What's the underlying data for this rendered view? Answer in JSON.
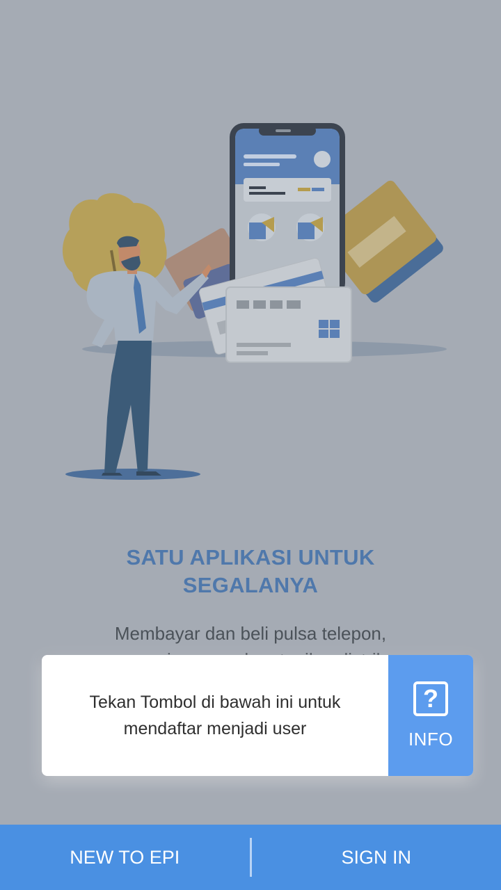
{
  "onboarding": {
    "title_line1": "SATU APLIKASI UNTUK",
    "title_line2": "SEGALANYA",
    "description_line1": "Membayar dan beli pulsa telepon,",
    "description_line2": "permainan voucher, tagihan listrik"
  },
  "tooltip": {
    "line1": "Tekan Tombol di bawah ini untuk",
    "line2": "mendaftar menjadi user",
    "info_label": "INFO",
    "info_icon": "question-mark-icon"
  },
  "bottom_bar": {
    "new_label": "NEW TO EPI",
    "signin_label": "SIGN IN"
  },
  "colors": {
    "overlay_background": "#a5abb4",
    "title": "#4f78ab",
    "info_button": "#5c9cee",
    "bottom_bar": "#4a90e2"
  }
}
